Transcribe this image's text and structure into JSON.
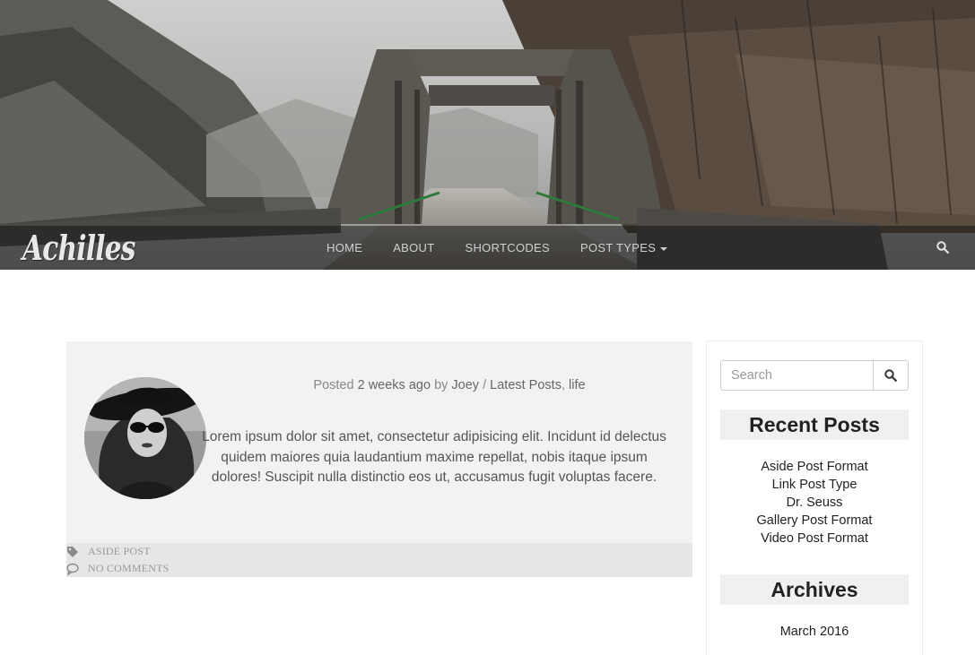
{
  "site": {
    "logo_text": "Achilles"
  },
  "nav": {
    "items": [
      {
        "label": "HOME"
      },
      {
        "label": "ABOUT"
      },
      {
        "label": "SHORTCODES"
      },
      {
        "label": "POST TYPES",
        "has_dropdown": true
      }
    ],
    "search_icon": "search-icon"
  },
  "post": {
    "meta": {
      "posted": "Posted",
      "time": "2 weeks ago",
      "by": "by",
      "author": "Joey",
      "separator": "/",
      "category1": "Latest Posts",
      "comma": ",",
      "category2": "life"
    },
    "excerpt": "Lorem ipsum dolor sit amet, consectetur adipisicing elit. Incidunt id delectus quidem maiores quia laudantium maxime repellat, nobis itaque ipsum dolores! Suscipit nulla distinctio eos ut, accusamus fugit voluptas facere.",
    "footer": {
      "format_label": "ASIDE POST",
      "comments_label": "NO COMMENTS",
      "format_icon": "tag-icon",
      "comments_icon": "comment-icon"
    }
  },
  "sidebar": {
    "search": {
      "placeholder": "Search",
      "value": ""
    },
    "recent_posts": {
      "title": "Recent Posts",
      "items": [
        "Aside Post Format",
        "Link Post Type",
        "Dr. Seuss",
        "Gallery Post Format",
        "Video Post Format"
      ]
    },
    "archives": {
      "title": "Archives",
      "items": [
        "March 2016"
      ]
    }
  },
  "colors": {
    "post_bg": "#f2f2f2",
    "post_footer_bg": "#e6e6e6",
    "widget_title_bg": "#f0f0f0",
    "nav_text": "#d0d0d0"
  }
}
